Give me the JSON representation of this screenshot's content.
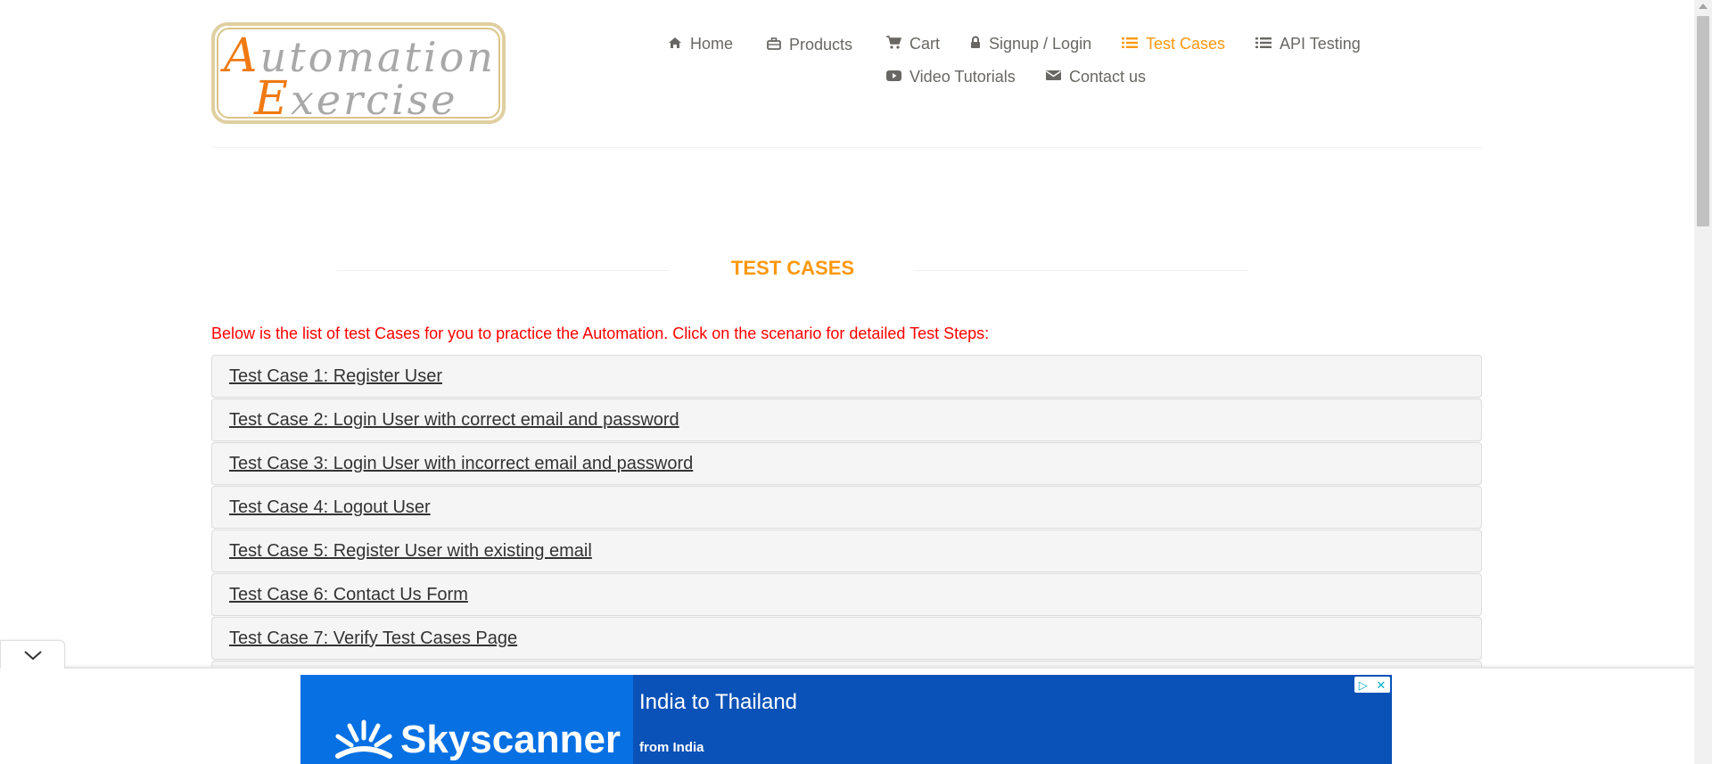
{
  "logo": {
    "line1_cap": "A",
    "line1_rest": "utomation",
    "line2_cap": "E",
    "line2_rest": "xercise",
    "colors": {
      "cap": "#f07a13",
      "text": "#a8a8a8",
      "border": "#e0cfa0"
    }
  },
  "nav": [
    {
      "label": "Home",
      "icon": "home-icon",
      "active": false
    },
    {
      "label": "Products",
      "icon": "briefcase-icon",
      "active": false
    },
    {
      "label": "Cart",
      "icon": "cart-icon",
      "active": false
    },
    {
      "label": "Signup / Login",
      "icon": "lock-icon",
      "active": false
    },
    {
      "label": "Test Cases",
      "icon": "list-icon",
      "active": true
    },
    {
      "label": "API Testing",
      "icon": "list-icon",
      "active": false
    },
    {
      "label": "Video Tutorials",
      "icon": "youtube-play-icon",
      "active": false
    },
    {
      "label": "Contact us",
      "icon": "envelope-icon",
      "active": false
    }
  ],
  "page": {
    "title": "TEST CASES",
    "intro": "Below is the list of test Cases for you to practice the Automation. Click on the scenario for detailed Test Steps:"
  },
  "test_cases": [
    "Test Case 1: Register User",
    "Test Case 2: Login User with correct email and password",
    "Test Case 3: Login User with incorrect email and password",
    "Test Case 4: Logout User",
    "Test Case 5: Register User with existing email",
    "Test Case 6: Contact Us Form",
    "Test Case 7: Verify Test Cases Page"
  ],
  "ad": {
    "brand": "Skyscanner",
    "headline": "India to Thailand",
    "subline": "from India",
    "badge_icons": [
      "adchoices-icon",
      "close-icon"
    ]
  },
  "colors": {
    "accent": "#fe980f",
    "intro_text": "#ff0000",
    "panel_bg": "#f5f5f5",
    "ad_bg": "#0a52b8",
    "ad_brand_bg": "#0770e3"
  }
}
